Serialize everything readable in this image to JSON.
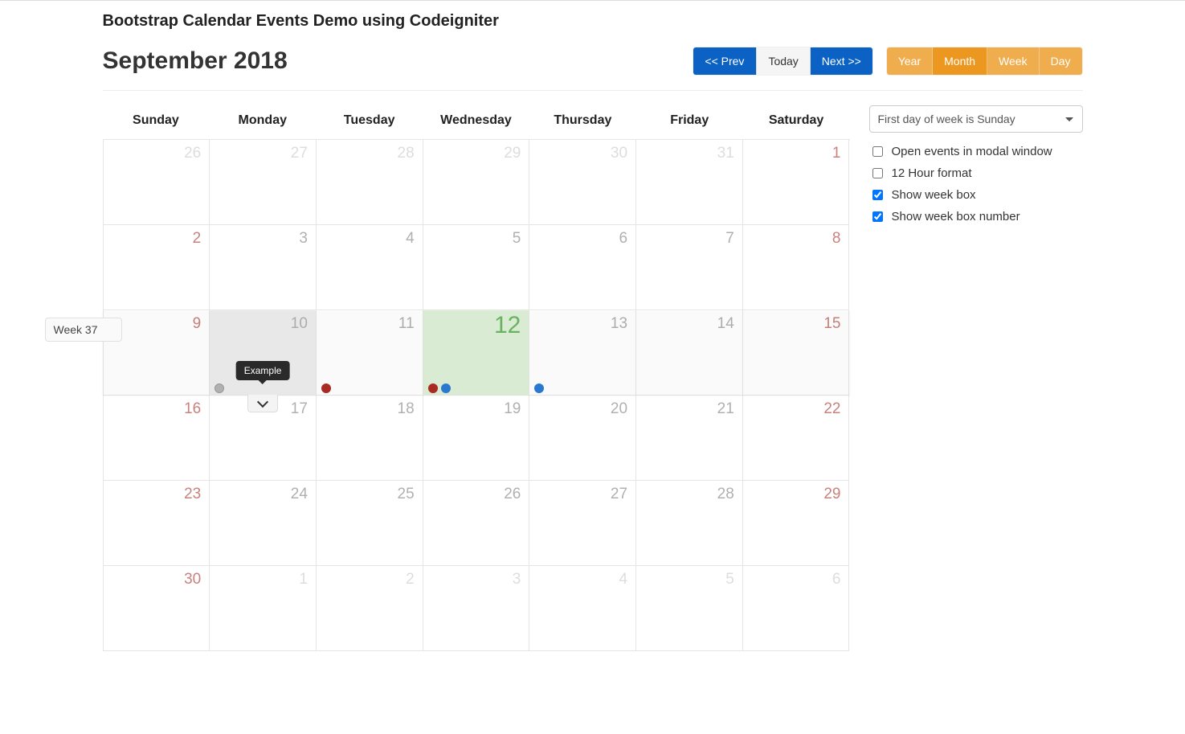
{
  "page_header": "Bootstrap Calendar Events Demo using Codeigniter",
  "month_title": "September 2018",
  "nav": {
    "prev": "<< Prev",
    "today": "Today",
    "next": "Next >>"
  },
  "views": {
    "year": "Year",
    "month": "Month",
    "week": "Week",
    "day": "Day",
    "active": "month"
  },
  "sidebar": {
    "first_day_select": "First day of week is Sunday",
    "options": [
      {
        "label": "Open events in modal window",
        "checked": false
      },
      {
        "label": "12 Hour format",
        "checked": false
      },
      {
        "label": "Show week box",
        "checked": true
      },
      {
        "label": "Show week box number",
        "checked": true
      }
    ]
  },
  "weekdays": [
    "Sunday",
    "Monday",
    "Tuesday",
    "Wednesday",
    "Thursday",
    "Friday",
    "Saturday"
  ],
  "week_tag": "Week 37",
  "tooltip_label": "Example",
  "days": [
    {
      "n": "26",
      "outside": true
    },
    {
      "n": "27",
      "outside": true
    },
    {
      "n": "28",
      "outside": true
    },
    {
      "n": "29",
      "outside": true
    },
    {
      "n": "30",
      "outside": true
    },
    {
      "n": "31",
      "outside": true
    },
    {
      "n": "1",
      "weekend": true
    },
    {
      "n": "2",
      "weekend": true
    },
    {
      "n": "3"
    },
    {
      "n": "4"
    },
    {
      "n": "5"
    },
    {
      "n": "6"
    },
    {
      "n": "7"
    },
    {
      "n": "8",
      "weekend": true
    },
    {
      "n": "9",
      "weekend": true
    },
    {
      "n": "10",
      "hovered": true,
      "events": [
        "gray"
      ],
      "tooltip": true,
      "expand": true
    },
    {
      "n": "11",
      "events": [
        "red"
      ]
    },
    {
      "n": "12",
      "today": true,
      "events": [
        "red",
        "blue"
      ]
    },
    {
      "n": "13",
      "events": [
        "blue"
      ]
    },
    {
      "n": "14"
    },
    {
      "n": "15",
      "weekend": true
    },
    {
      "n": "16",
      "weekend": true
    },
    {
      "n": "17"
    },
    {
      "n": "18"
    },
    {
      "n": "19"
    },
    {
      "n": "20"
    },
    {
      "n": "21"
    },
    {
      "n": "22",
      "weekend": true
    },
    {
      "n": "23",
      "weekend": true
    },
    {
      "n": "24"
    },
    {
      "n": "25"
    },
    {
      "n": "26"
    },
    {
      "n": "27"
    },
    {
      "n": "28"
    },
    {
      "n": "29",
      "weekend": true
    },
    {
      "n": "30",
      "weekend": true
    },
    {
      "n": "1",
      "outside": true
    },
    {
      "n": "2",
      "outside": true
    },
    {
      "n": "3",
      "outside": true
    },
    {
      "n": "4",
      "outside": true
    },
    {
      "n": "5",
      "outside": true
    },
    {
      "n": "6",
      "outside": true
    }
  ]
}
